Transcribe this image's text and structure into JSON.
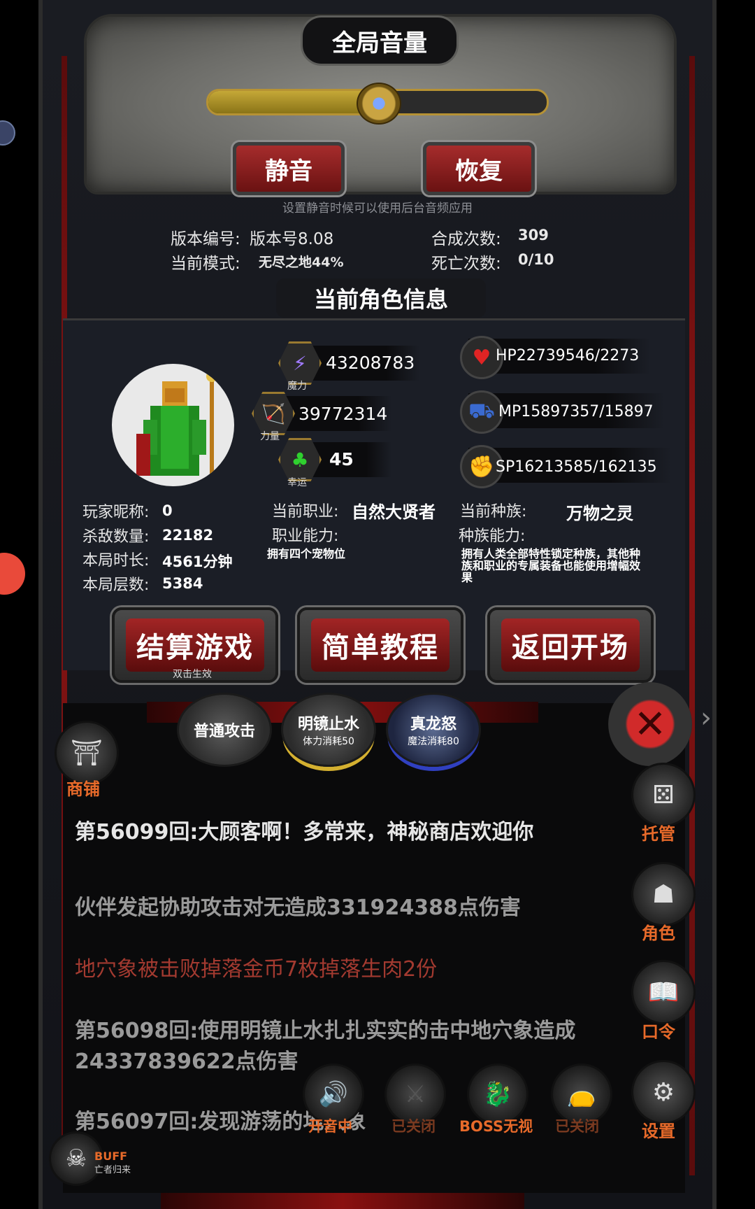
{
  "volume": {
    "title": "全局音量",
    "level_percent": 50,
    "mute_label": "静音",
    "restore_label": "恢复",
    "hint": "设置静音时候可以使用后台音频应用"
  },
  "game_info": {
    "version_label": "版本编号:",
    "version_value": "版本号8.08",
    "mode_label": "当前模式:",
    "mode_value": "无尽之地44%",
    "synth_label": "合成次数:",
    "synth_value": "309",
    "death_label": "死亡次数:",
    "death_value": "0/10"
  },
  "character": {
    "section_title": "当前角色信息",
    "magic_label": "魔力",
    "magic_value": "43208783",
    "strength_label": "力量",
    "strength_value": "39772314",
    "luck_label": "幸运",
    "luck_value": "45",
    "hp": "HP22739546/2273",
    "mp": "MP15897357/15897",
    "sp": "SP16213585/162135",
    "nickname_label": "玩家昵称:",
    "nickname_value": "0",
    "kills_label": "杀敌数量:",
    "kills_value": "22182",
    "duration_label": "本局时长:",
    "duration_value": "4561分钟",
    "floors_label": "本局层数:",
    "floors_value": "5384",
    "job_label": "当前职业:",
    "job_value": "自然大贤者",
    "job_ability_label": "职业能力:",
    "job_ability_value": "拥有四个宠物位",
    "race_label": "当前种族:",
    "race_value": "万物之灵",
    "race_ability_label": "种族能力:",
    "race_ability_value": "拥有人类全部特性锁定种族，其他种族和职业的专属装备也能使用增幅效果"
  },
  "actions": {
    "settle_label": "结算游戏",
    "settle_sub": "双击生效",
    "tutorial_label": "简单教程",
    "return_label": "返回开场"
  },
  "skills": [
    {
      "name": "普通攻击",
      "cost": ""
    },
    {
      "name": "明镜止水",
      "cost": "体力消耗50"
    },
    {
      "name": "真龙怒",
      "cost": "魔法消耗80"
    }
  ],
  "side_menu": {
    "shop": "商铺",
    "auto": "托管",
    "role": "角色",
    "code": "口令",
    "settings": "设置"
  },
  "log": [
    {
      "text": "第56099回:大顾客啊！多常来，神秘商店欢迎你",
      "color": "#e6e6e6"
    },
    {
      "text": "伙伴发起协助攻击对无造成331924388点伤害",
      "color": "#9a9a9a"
    },
    {
      "text": "地穴象被击败掉落金币7枚掉落生肉2份",
      "color": "#a33a30"
    },
    {
      "text": "第56098回:使用明镜止水扎扎实实的击中地穴象造成24337839622点伤害",
      "color": "#9a9a9a"
    },
    {
      "text": "第56097回:发现游荡的地穴象",
      "color": "#9a9a9a"
    }
  ],
  "toggles": [
    {
      "label": "开音中",
      "color": "#e76a2a",
      "icon": "speaker-icon"
    },
    {
      "label": "已关闭",
      "color": "#7a3a20",
      "icon": "sword-icon"
    },
    {
      "label": "BOSS无视",
      "color": "#e76a2a",
      "icon": "dragon-icon"
    },
    {
      "label": "已关闭",
      "color": "#7a3a20",
      "icon": "bag-icon"
    }
  ],
  "buff": {
    "title": "BUFF",
    "sub": "亡者归来"
  },
  "colors": {
    "accent_orange": "#e76a2a",
    "panel_red": "#a62c2c",
    "gold": "#b69234"
  }
}
